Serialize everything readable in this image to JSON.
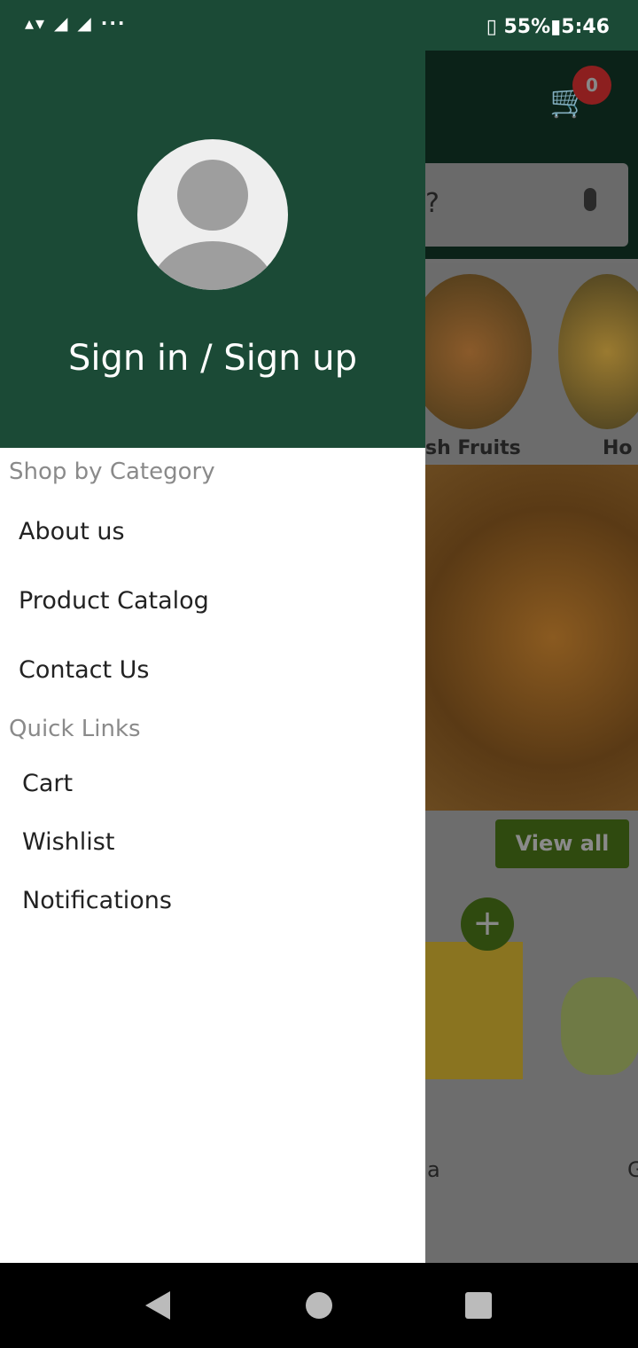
{
  "status": {
    "left_icons": "▴▾ ◢ ◢ ···",
    "battery": "55%",
    "time": "5:46"
  },
  "background": {
    "cart_count": "0",
    "search_placeholder": "?",
    "categories": [
      "sh Fruits",
      "Ho"
    ],
    "view_all": "View all",
    "add": "+",
    "products": [
      "a",
      "G"
    ]
  },
  "drawer": {
    "sign_in": "Sign in / Sign up",
    "shop_header": "Shop by Category",
    "shop_items": [
      "About us",
      "Product Catalog",
      "Contact Us"
    ],
    "quick_header": "Quick Links",
    "quick_items": [
      "Cart",
      "Wishlist",
      "Notifications"
    ]
  },
  "colors": {
    "primary": "#1b4a36",
    "badge": "#c62828",
    "accent": "#4c7a1a"
  }
}
